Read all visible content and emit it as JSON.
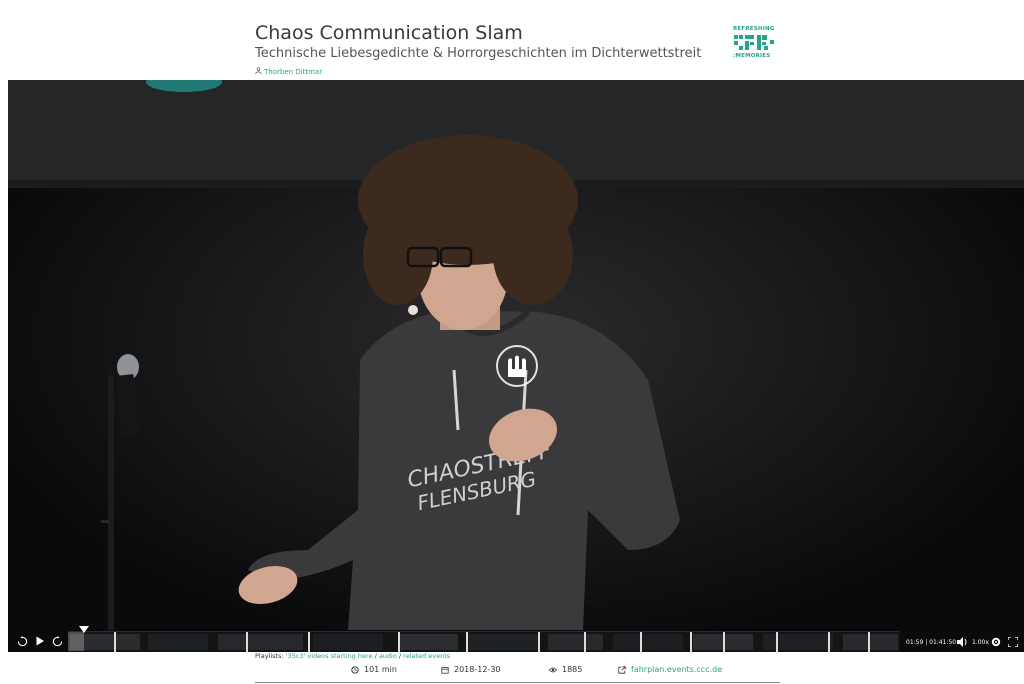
{
  "header": {
    "title": "Chaos Communication Slam",
    "subtitle": "Technische Liebesgedichte & Horrorgeschichten im Dichterwettstreit",
    "speaker": "Thorben Dittmar",
    "logo_top": "REFRESHING",
    "logo_bottom": ":MEMORIES"
  },
  "player": {
    "current_time": "01:59",
    "total_time": "01:41:50",
    "time_display": "01:59 | 01:41:50",
    "speed": "1.00x",
    "progress_fraction": 0.0195
  },
  "below": {
    "playlists_label": "Playlists:",
    "playlist_links": [
      "'35c3' videos starting here",
      "audio",
      "related events"
    ],
    "duration": "101 min",
    "date": "2018-12-30",
    "views": "1885",
    "fahrplan": "fahrplan.events.ccc.de"
  },
  "colors": {
    "accent": "#27a38b",
    "title": "#3a3a3a"
  }
}
